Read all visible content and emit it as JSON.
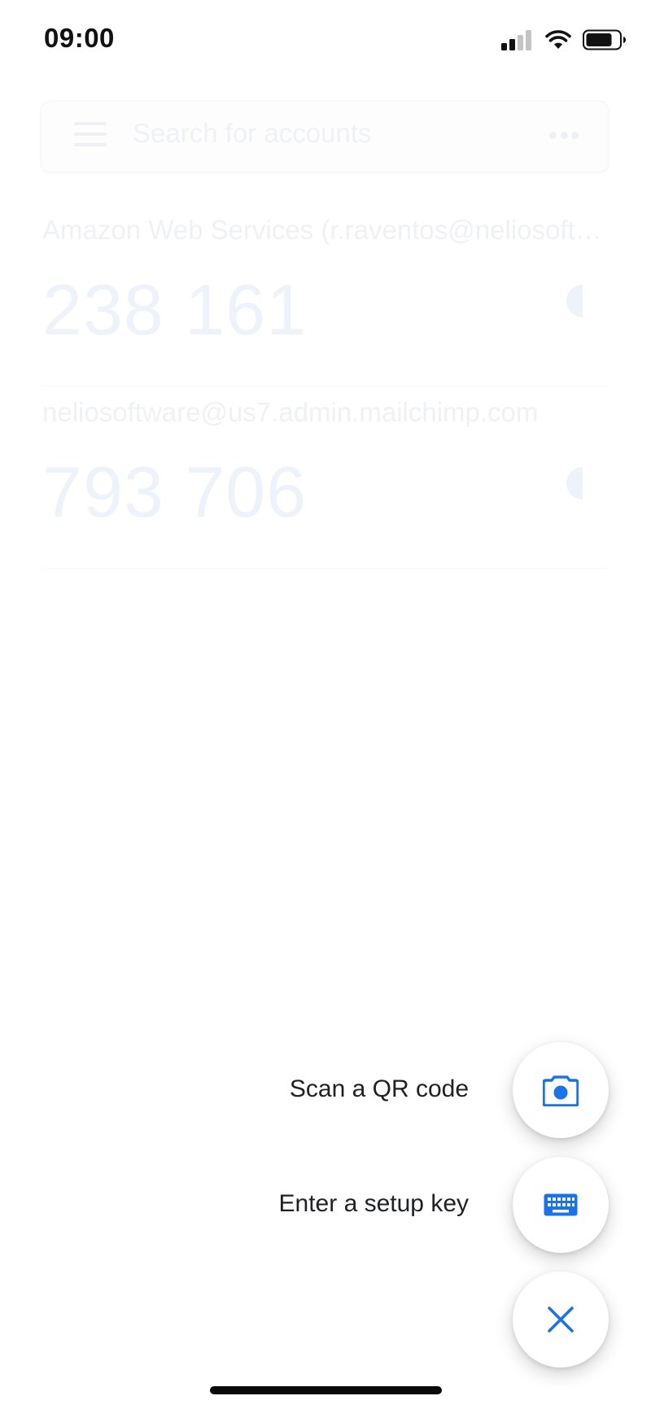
{
  "status_bar": {
    "time": "09:00",
    "icons": [
      "signal-icon",
      "wifi-icon",
      "battery-icon"
    ]
  },
  "search": {
    "placeholder": "Search for accounts"
  },
  "accounts": [
    {
      "name": "Amazon Web Services (r.raventos@neliosoftware.com)",
      "code": "238 161"
    },
    {
      "name": "neliosoftware@us7.admin.mailchimp.com",
      "code": "793 706"
    }
  ],
  "speed_dial": {
    "scan_label": "Scan a QR code",
    "setup_key_label": "Enter a setup key",
    "icons": [
      "camera-icon",
      "keyboard-icon",
      "close-icon"
    ]
  },
  "colors": {
    "accent": "#1a73e8",
    "label_text": "#202124",
    "faded_text": "#f0f1f4"
  }
}
